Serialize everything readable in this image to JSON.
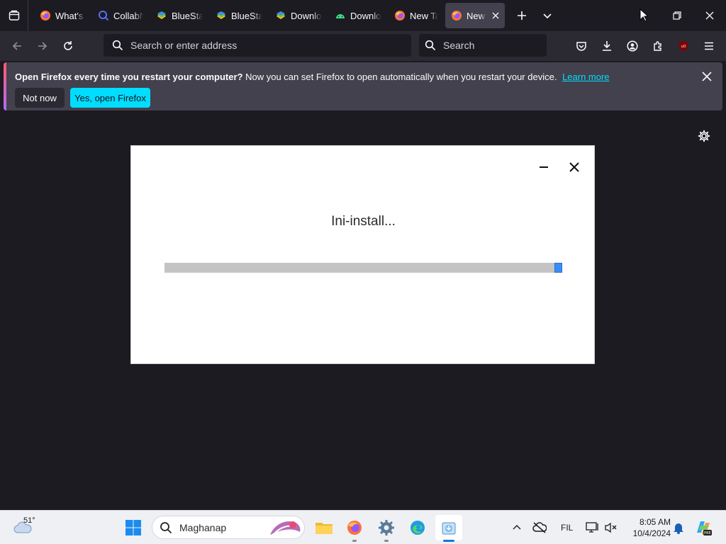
{
  "tabs": [
    {
      "label": "What's new",
      "icon": "firefox-icon",
      "active": false
    },
    {
      "label": "CollabNet",
      "icon": "collab-icon",
      "active": false
    },
    {
      "label": "BlueStacks",
      "icon": "bluestacks-icon",
      "active": false
    },
    {
      "label": "BlueStacks",
      "icon": "bluestacks-icon",
      "active": false
    },
    {
      "label": "Download",
      "icon": "bluestacks-icon",
      "active": false
    },
    {
      "label": "Download",
      "icon": "android-icon",
      "active": false
    },
    {
      "label": "New Tab",
      "icon": "firefox-icon",
      "active": false
    },
    {
      "label": "New Tab",
      "icon": "firefox-icon",
      "active": true
    }
  ],
  "navbar": {
    "url_placeholder": "Search or enter address",
    "search_placeholder": "Search"
  },
  "notification": {
    "bold": "Open Firefox every time you restart your computer?",
    "text": "Now you can set Firefox to open automatically when you restart your device.",
    "link": "Learn more",
    "not_now": "Not now",
    "yes": "Yes, open Firefox"
  },
  "installer": {
    "status": "Ini-install...",
    "progress": 0.98
  },
  "taskbar": {
    "weather_temp": "51°",
    "search_placeholder": "Maghanap",
    "language": "FIL",
    "time": "8:05 AM",
    "date": "10/4/2024"
  },
  "colors": {
    "accent": "#00ddff",
    "progress_fill": "#3a8df5",
    "background": "#1c1b22"
  }
}
